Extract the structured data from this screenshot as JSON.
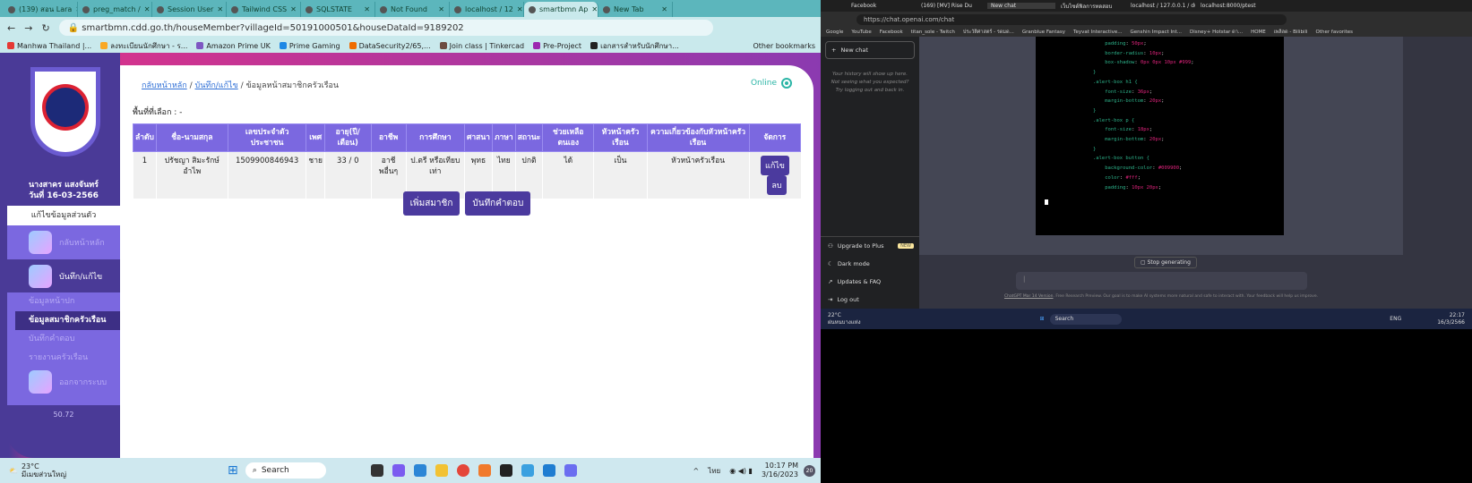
{
  "left_browser": {
    "tabs": [
      {
        "label": "(139) สอน Lara"
      },
      {
        "label": "preg_match /"
      },
      {
        "label": "Session User"
      },
      {
        "label": "Tailwind CSS"
      },
      {
        "label": "SQLSTATE"
      },
      {
        "label": "Not Found"
      },
      {
        "label": "localhost / 12"
      },
      {
        "label": "smartbmn Ap",
        "active": true
      },
      {
        "label": "New Tab"
      }
    ],
    "url": "smartbmn.cdd.go.th/houseMember?villageId=50191000501&houseDataId=9189202",
    "bookmarks": [
      "Manhwa Thailand |...",
      "ลงทะเบียนนักศึกษา - ร...",
      "Amazon Prime UK",
      "Prime Gaming",
      "DataSecurity2/65,...",
      "Join class | Tinkercad",
      "Pre-Project",
      "เอกสารสำหรับนักศึกษา..."
    ],
    "other_bookmarks": "Other bookmarks"
  },
  "sidebar": {
    "user_name": "นางสาคร แสงจันทร์",
    "date": "วันที่ 16-03-2566",
    "edit_profile": "แก้ไขข้อมูลส่วนตัว",
    "home": "กลับหน้าหลัก",
    "record": "บันทึก/แก้ไข",
    "sub_items": [
      "ข้อมูลหน้าปก",
      "ข้อมูลสมาชิกครัวเรือน",
      "บันทึกคำตอบ",
      "รายงานครัวเรือน"
    ],
    "logout": "ออกจากระบบ",
    "version": "50.72"
  },
  "main": {
    "breadcrumb": {
      "home": "กลับหน้าหลัก",
      "record": "บันทึก/แก้ไข",
      "current": "ข้อมูลหน้าสมาชิกครัวเรือน",
      "sep": "/"
    },
    "status": "Online",
    "area": "พื้นที่ที่เลือก : -",
    "columns": [
      "ลำดับ",
      "ชื่อ-นามสกุล",
      "เลขประจำตัวประชาชน",
      "เพศ",
      "อายุ(ปี/เดือน)",
      "อาชีพ",
      "การศึกษา",
      "ศาสนา",
      "ภาษา",
      "สถานะ",
      "ช่วยเหลือตนเอง",
      "หัวหน้าครัวเรือน",
      "ความเกี่ยวข้องกับหัวหน้าครัวเรือน",
      "จัดการ"
    ],
    "rows": [
      {
        "no": "1",
        "name": "ปรัชญา สิมะรักษ์ อำไพ",
        "id": "1509900846943",
        "sex": "ชาย",
        "age": "33 / 0",
        "job": "อาชีพอื่นๆ",
        "edu": "ป.ตรี หรือเทียบเท่า",
        "religion": "พุทธ",
        "lang": "ไทย",
        "status": "ปกติ",
        "self": "ได้",
        "head": "เป็น",
        "relation": "หัวหน้าครัวเรือน",
        "edit": "แก้ไข",
        "delete": "ลบ"
      }
    ],
    "add_member": "เพิ่มสมาชิก",
    "save_answer": "บันทึกคำตอบ"
  },
  "taskbar_left": {
    "weather_temp": "23°C",
    "weather_desc": "มีเมฆส่วนใหญ่",
    "search": "Search",
    "lang": "ไทย",
    "time": "10:17 PM",
    "date": "3/16/2023",
    "badge": "20"
  },
  "right_browser": {
    "tabs": [
      "Facebook",
      "(169) [MV] Rise Du",
      "New chat",
      "เว็บไซต์ฟิลการทดสอบ",
      "localhost / 127.0.0.1 / du",
      "localhost:8000/ptest"
    ],
    "url": "https://chat.openai.com/chat",
    "bookmarks": [
      "Google",
      "YouTube",
      "Facebook",
      "titan_sole - Twitch",
      "ประวัติศาสตร์ - รดมด...",
      "Granblue Fantasy",
      "Teyvat Interactive...",
      "Genshin Impact Int...",
      "Disney+ Hotstar ดา...",
      "HOME",
      "เพลิลด - Bilibili",
      "Other favorites"
    ],
    "new_chat": "New chat",
    "history_note": "Your history will show up here. Not seeing what you expected? Try logging out and back in.",
    "upgrade": "Upgrade to Plus",
    "new_badge": "NEW",
    "dark_mode": "Dark mode",
    "updates": "Updates & FAQ",
    "logout": "Log out",
    "code_lines": [
      [
        "    ",
        "padding",
        ": ",
        "50px",
        ";"
      ],
      [
        "    ",
        "border-radius",
        ": ",
        "10px",
        ";"
      ],
      [
        "    ",
        "box-shadow",
        ": ",
        "0px 0px 10px #999",
        ";"
      ],
      [
        "",
        "}",
        "",
        "",
        ""
      ],
      [
        "",
        "",
        "",
        "",
        ""
      ],
      [
        "",
        ".alert-box h1 {",
        "",
        "",
        ""
      ],
      [
        "    ",
        "font-size",
        ": ",
        "36px",
        ";"
      ],
      [
        "    ",
        "margin-bottom",
        ": ",
        "20px",
        ";"
      ],
      [
        "",
        "}",
        "",
        "",
        ""
      ],
      [
        "",
        "",
        "",
        "",
        ""
      ],
      [
        "",
        ".alert-box p {",
        "",
        "",
        ""
      ],
      [
        "    ",
        "font-size",
        ": ",
        "18px",
        ";"
      ],
      [
        "    ",
        "margin-bottom",
        ": ",
        "20px",
        ";"
      ],
      [
        "",
        "}",
        "",
        "",
        ""
      ],
      [
        "",
        "",
        "",
        "",
        ""
      ],
      [
        "",
        ".alert-box button {",
        "",
        "",
        ""
      ],
      [
        "    ",
        "background-color",
        ": ",
        "#009900",
        ";"
      ],
      [
        "    ",
        "color",
        ": ",
        "#fff",
        ";"
      ],
      [
        "    ",
        "padding",
        ": ",
        "10px 20px",
        ";"
      ]
    ],
    "stop": "Stop generating",
    "footer_link": "ChatGPT Mar 14 Version",
    "footer": ". Free Research Preview. Our goal is to make AI systems more natural and safe to interact with. Your feedback will help us improve."
  },
  "taskbar_right": {
    "temp": "22°C",
    "desc": "ฝนหนบางแห่ง",
    "search": "Search",
    "lang": "ENG",
    "time": "22:17",
    "date": "16/3/2566"
  }
}
